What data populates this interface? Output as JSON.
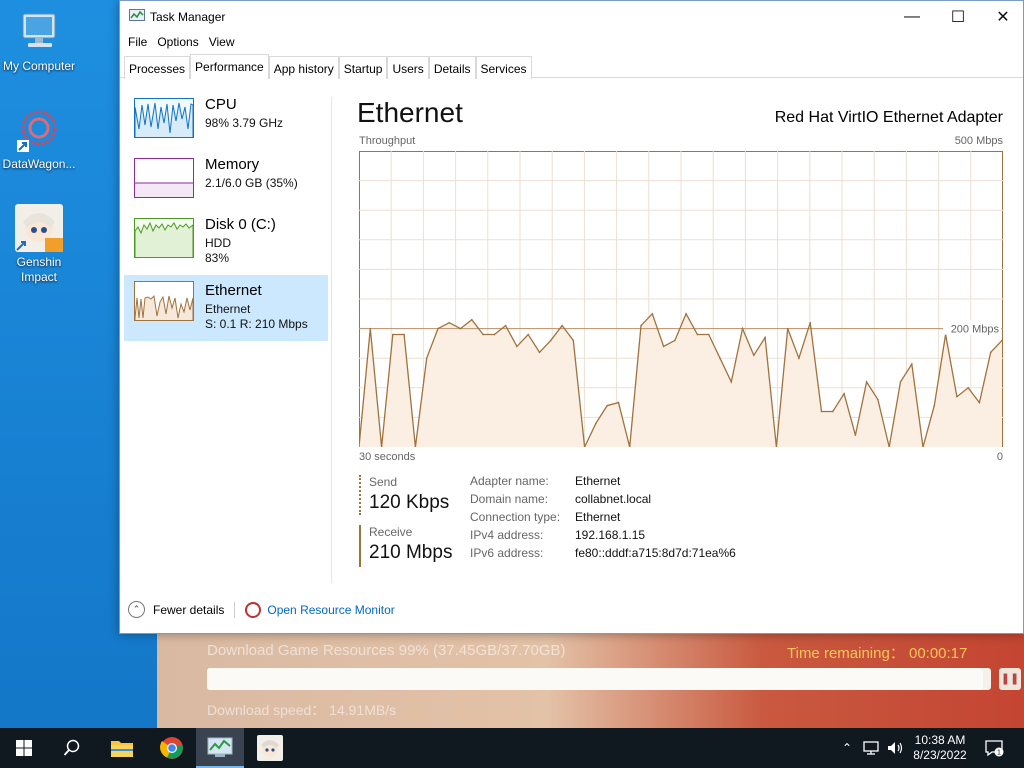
{
  "desktop": {
    "icons": [
      {
        "label": "My Computer"
      },
      {
        "label": "DataWagon..."
      },
      {
        "label": "Genshin Impact"
      }
    ]
  },
  "launcher": {
    "download_title": "Download Game Resources 99% (37.45GB/37.70GB)",
    "time_remaining": "Time remaining： 00:00:17",
    "download_speed": "Download speed： 14.91MB/s",
    "progress_percent": 99
  },
  "window": {
    "title": "Task Manager",
    "controls": {
      "minimize": "—",
      "maximize": "☐",
      "close": "✕"
    }
  },
  "menu": [
    "File",
    "Options",
    "View"
  ],
  "tabs": [
    "Processes",
    "Performance",
    "App history",
    "Startup",
    "Users",
    "Details",
    "Services"
  ],
  "active_tab": "Performance",
  "resources": [
    {
      "name": "CPU",
      "sub1": "98%  3.79 GHz",
      "sub2": "",
      "color": "#1173c5"
    },
    {
      "name": "Memory",
      "sub1": "2.1/6.0 GB (35%)",
      "sub2": "",
      "color": "#8b2d9a"
    },
    {
      "name": "Disk 0 (C:)",
      "sub1": "HDD",
      "sub2": "83%",
      "color": "#4c9a22"
    },
    {
      "name": "Ethernet",
      "sub1": "Ethernet",
      "sub2": "S: 0.1  R: 210 Mbps",
      "color": "#a0733e"
    }
  ],
  "panel": {
    "title": "Ethernet",
    "adapter": "Red Hat VirtIO Ethernet Adapter",
    "throughput_label": "Throughput",
    "max_label": "500 Mbps",
    "mid_label": "200 Mbps",
    "time_label": "30 seconds",
    "zero_label": "0",
    "send_label": "Send",
    "send_value": "120 Kbps",
    "receive_label": "Receive",
    "receive_value": "210 Mbps",
    "properties": [
      {
        "key": "Adapter name:",
        "value": "Ethernet"
      },
      {
        "key": "Domain name:",
        "value": "collabnet.local"
      },
      {
        "key": "Connection type:",
        "value": "Ethernet"
      },
      {
        "key": "IPv4 address:",
        "value": "192.168.1.15"
      },
      {
        "key": "IPv6 address:",
        "value": "fe80::dddf:a715:8d7d:71ea%6"
      }
    ]
  },
  "footer": {
    "fewer_details": "Fewer details",
    "open_resmon": "Open Resource Monitor"
  },
  "chart_data": {
    "type": "area",
    "title": "Throughput",
    "xlabel": "",
    "ylabel": "",
    "ylim": [
      0,
      500
    ],
    "scale_reference": 200,
    "series": [
      {
        "values": [
          0,
          200,
          0,
          190,
          190,
          0,
          150,
          200,
          210,
          200,
          215,
          190,
          190,
          205,
          170,
          190,
          160,
          180,
          205,
          180,
          0,
          40,
          70,
          75,
          0,
          205,
          225,
          170,
          180,
          225,
          190,
          190,
          150,
          110,
          200,
          155,
          185,
          0,
          200,
          150,
          210,
          60,
          60,
          90,
          20,
          110,
          80,
          0,
          110,
          140,
          0,
          70,
          190,
          85,
          100,
          75,
          160,
          180
        ]
      }
    ]
  },
  "taskbar": {
    "time": "10:38 AM",
    "date": "8/23/2022",
    "notification_count": "1"
  }
}
